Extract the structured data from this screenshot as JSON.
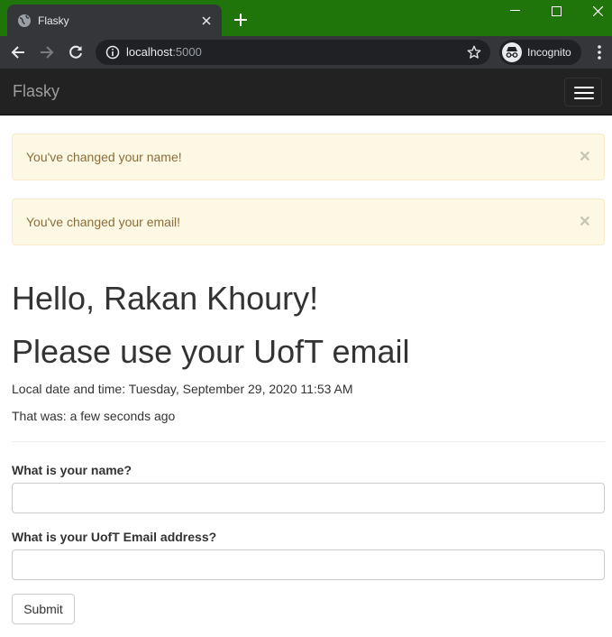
{
  "browser": {
    "tab_title": "Flasky",
    "url_host": "localhost",
    "url_port": ":5000",
    "incognito_label": "Incognito"
  },
  "navbar": {
    "brand": "Flasky"
  },
  "alerts": [
    {
      "message": "You've changed your name!",
      "close": "×"
    },
    {
      "message": "You've changed your email!",
      "close": "×"
    }
  ],
  "content": {
    "greeting": "Hello, Rakan Khoury!",
    "warning": "Please use your UofT email",
    "local_time": "Local date and time: Tuesday, September 29, 2020 11:53 AM",
    "relative_time": "That was: a few seconds ago"
  },
  "form": {
    "name_label": "What is your name?",
    "name_value": "",
    "email_label": "What is your UofT Email address?",
    "email_value": "",
    "submit_label": "Submit"
  },
  "colors": {
    "titlebar": "#1f740a",
    "chrome_toolbar": "#35363a",
    "navbar": "#222222",
    "alert_bg": "#fcf8e3",
    "alert_text": "#8a6d3b"
  }
}
